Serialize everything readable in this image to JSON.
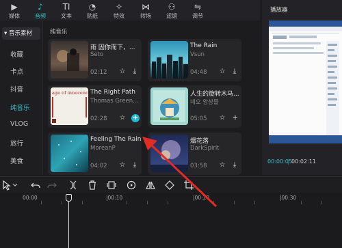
{
  "topbar": {
    "tabs": [
      {
        "label": "媒体",
        "icon": "media-icon",
        "glyph": "▶"
      },
      {
        "label": "音频",
        "icon": "audio-icon",
        "glyph": "♪",
        "active": true
      },
      {
        "label": "文本",
        "icon": "text-icon",
        "glyph": "TI"
      },
      {
        "label": "贴纸",
        "icon": "sticker-icon",
        "glyph": "◔"
      },
      {
        "label": "特效",
        "icon": "effects-icon",
        "glyph": "✧"
      },
      {
        "label": "转场",
        "icon": "transition-icon",
        "glyph": "⋈"
      },
      {
        "label": "滤镜",
        "icon": "filter-icon",
        "glyph": "⚇"
      },
      {
        "label": "调节",
        "icon": "adjust-icon",
        "glyph": "⇋"
      }
    ]
  },
  "sidebar": {
    "header": "▾ 音乐素材",
    "items": [
      "收藏",
      "卡点",
      "抖音",
      "纯音乐",
      "VLOG",
      "旅行",
      "美食"
    ],
    "active_index": 3
  },
  "music": {
    "section_title": "纯音乐",
    "tracks": [
      {
        "title": "雨 因你而下，...",
        "artist": "Seto",
        "duration": "02:12",
        "action": "download"
      },
      {
        "title": "The Rain",
        "artist": "Vsun",
        "duration": "04:48",
        "action": "download"
      },
      {
        "title": "The Right Path",
        "artist": "Thomas Green...",
        "duration": "02:28",
        "action": "add",
        "cover_text": "age of innocence"
      },
      {
        "title": "人生的旋转木马...",
        "artist": "네오 앙상블",
        "duration": "05:05",
        "action": "add"
      },
      {
        "title": "Feeling The Rain",
        "artist": "MoreanP",
        "duration": "04:02",
        "action": "download"
      },
      {
        "title": "烟花落",
        "artist": "DarkSpirit",
        "duration": "03:58",
        "action": "download"
      }
    ]
  },
  "player": {
    "title": "播放器",
    "current_time": "00:00:05",
    "separator": "|",
    "total_time": "00:02:11"
  },
  "toolbar": {
    "tools": [
      "select-tool-icon",
      "undo-icon",
      "redo-icon",
      "split-icon",
      "delete-icon",
      "freeze-frame-icon",
      "reverse-icon",
      "mirror-icon",
      "rotate-icon",
      "crop-icon"
    ]
  },
  "timeline": {
    "ruler_labels": [
      "00:00",
      "|00:10",
      "|00:20",
      "|00:30"
    ]
  },
  "colors": {
    "accent": "#2fc6d3",
    "annotation_arrow": "#e02c25"
  }
}
